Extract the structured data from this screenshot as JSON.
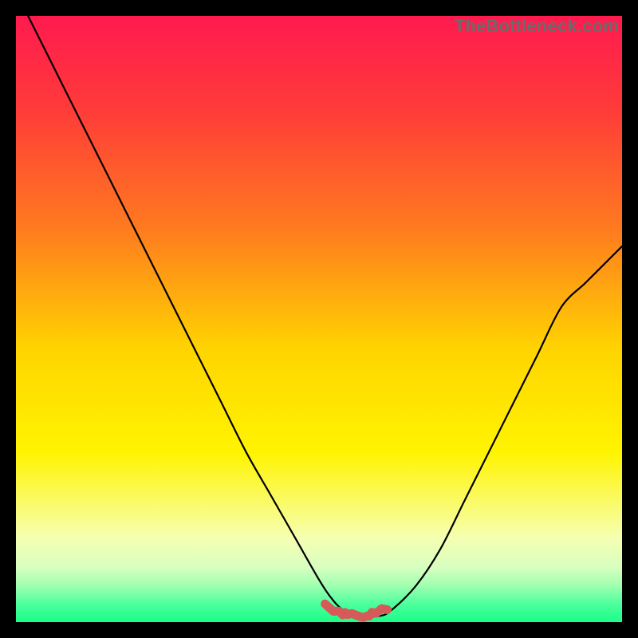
{
  "watermark": "TheBottleneck.com",
  "colors": {
    "frame": "#000000",
    "watermark": "#6b6b6b",
    "curve": "#000000",
    "rough_segment": "#d75a5a",
    "gradient_stops": [
      {
        "offset": 0.0,
        "color": "#ff1a4f"
      },
      {
        "offset": 0.15,
        "color": "#ff3a3a"
      },
      {
        "offset": 0.35,
        "color": "#ff7a1f"
      },
      {
        "offset": 0.55,
        "color": "#ffd400"
      },
      {
        "offset": 0.72,
        "color": "#fff400"
      },
      {
        "offset": 0.86,
        "color": "#f6ffb0"
      },
      {
        "offset": 0.91,
        "color": "#d8ffc0"
      },
      {
        "offset": 0.94,
        "color": "#a0ffb0"
      },
      {
        "offset": 0.97,
        "color": "#4dff9d"
      },
      {
        "offset": 1.0,
        "color": "#1aff88"
      }
    ]
  },
  "chart_data": {
    "type": "line",
    "title": "",
    "xlabel": "",
    "ylabel": "",
    "x_range": [
      0,
      100
    ],
    "y_range": [
      0,
      100
    ],
    "series": [
      {
        "name": "bottleneck-curve",
        "x": [
          2,
          6,
          10,
          14,
          18,
          22,
          26,
          30,
          34,
          38,
          42,
          46,
          50,
          52,
          54,
          57,
          60,
          62,
          66,
          70,
          74,
          78,
          82,
          86,
          90,
          94,
          98,
          100
        ],
        "y": [
          100,
          92,
          84,
          76,
          68,
          60,
          52,
          44,
          36,
          28,
          21,
          14,
          7,
          4,
          2,
          1,
          1,
          2,
          6,
          12,
          20,
          28,
          36,
          44,
          52,
          56,
          60,
          62
        ]
      }
    ],
    "rough_segment": {
      "name": "optimal-range",
      "x": [
        51,
        53,
        55,
        57,
        59,
        61
      ],
      "y": [
        3.0,
        1.6,
        1.2,
        1.0,
        1.3,
        2.2
      ]
    },
    "note": "x and y in percent of plot area; y=0 is bottom (green), y=100 is top (red). The rough_segment marks the flat minimum drawn with a thick desaturated-red stroke."
  }
}
